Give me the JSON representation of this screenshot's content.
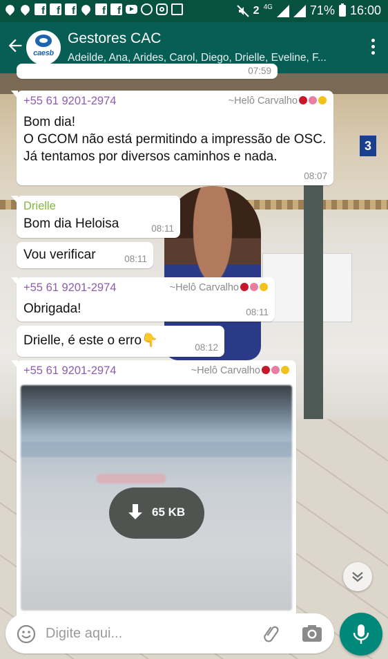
{
  "status_bar": {
    "network": "4G",
    "battery_percent": "71%",
    "time": "16:00",
    "sim_indicator": "2"
  },
  "app_bar": {
    "avatar_brand": "caesb",
    "title": "Gestores CAC",
    "members": "Adeilde, Ana, Arides, Carol, Diego, Drielle, Eveline, F..."
  },
  "previous_time": "07:59",
  "messages": [
    {
      "sender": "+55 61 9201-2974",
      "alias": "~Helô Carvalho",
      "text": "Bom dia!\nO GCOM não está permitindo a impressão de OSC. Já tentamos por diversos caminhos e nada.",
      "time": "08:07"
    },
    {
      "sender": "Drielle",
      "text": "Bom dia Heloisa",
      "time": "08:11"
    },
    {
      "text": "Vou verificar",
      "time": "08:11"
    },
    {
      "sender": "+55 61 9201-2974",
      "alias": "~Helô Carvalho",
      "text": "Obrigada!",
      "time": "08:11"
    },
    {
      "text": "Drielle, é este o erro👇",
      "time": "08:12"
    },
    {
      "sender": "+55 61 9201-2974",
      "alias": "~Helô Carvalho",
      "download_size": "65 KB"
    }
  ],
  "wallpaper_sign": "3",
  "composer": {
    "placeholder": "Digite aqui..."
  },
  "colors": {
    "header": "#075e54",
    "status_bar": "#06513f",
    "sender_number": "#8e5cae",
    "sender_named": "#83b935",
    "fab": "#00897b"
  },
  "icons": [
    "back-arrow-icon",
    "overflow-menu-icon",
    "download-icon",
    "chevron-double-down-icon",
    "emoji-icon",
    "attach-icon",
    "camera-icon",
    "mic-icon"
  ]
}
